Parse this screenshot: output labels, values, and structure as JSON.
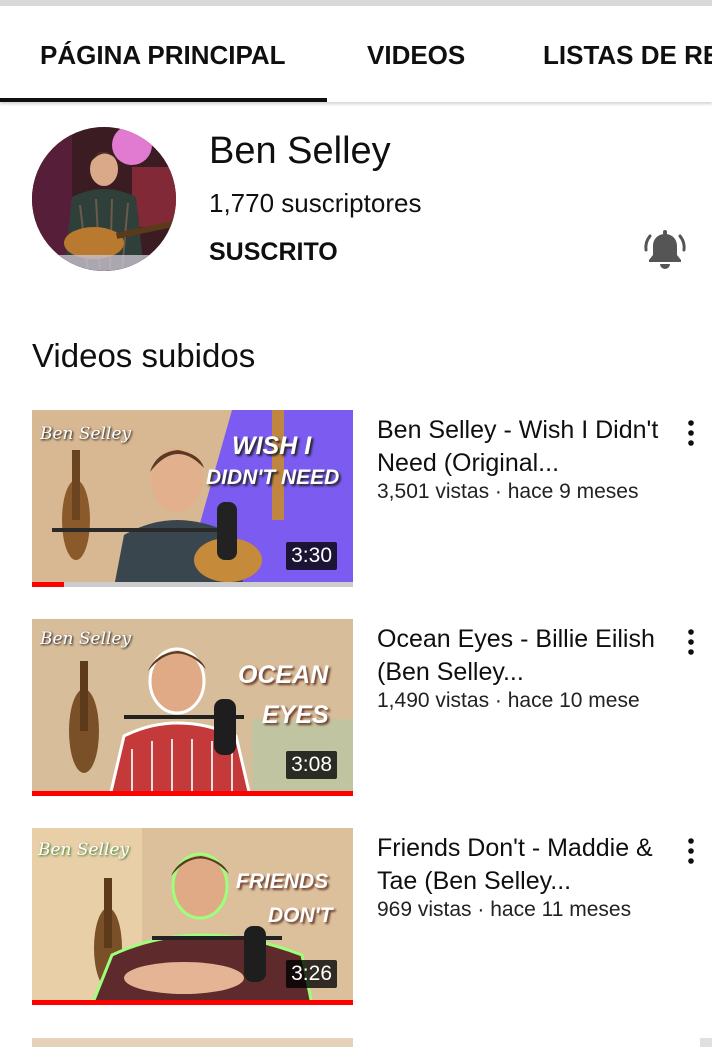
{
  "tabs": [
    {
      "label": "PÁGINA PRINCIPAL",
      "active": true
    },
    {
      "label": "VIDEOS",
      "active": false
    },
    {
      "label": "LISTAS DE RE",
      "active": false
    }
  ],
  "channel": {
    "name": "Ben Selley",
    "subscribers": "1,770 suscriptores",
    "subscribe_state": "SUSCRITO",
    "bell_icon": "notification-bell-icon"
  },
  "section": {
    "title": "Videos subidos"
  },
  "videos": [
    {
      "title": "Ben Selley - Wish I Didn't Need (Original...",
      "meta": "3,501 vistas · hace 9 meses",
      "duration": "3:30",
      "thumb_brand": "Ben Selley",
      "thumb_text": [
        "WISH I",
        "DIDN'T NEED"
      ],
      "watched_fraction": 0.1
    },
    {
      "title": "Ocean Eyes - Billie Eilish (Ben Selley...",
      "meta": "1,490 vistas · hace 10 mese",
      "duration": "3:08",
      "thumb_brand": "Ben Selley",
      "thumb_text": [
        "OCEAN",
        "EYES"
      ],
      "watched_fraction": 1.0
    },
    {
      "title": "Friends Don't - Maddie & Tae (Ben Selley...",
      "meta": "969 vistas · hace 11 meses",
      "duration": "3:26",
      "thumb_brand": "Ben Selley",
      "thumb_text": [
        "FRIENDS",
        "DON'T"
      ],
      "watched_fraction": 1.0
    }
  ],
  "colors": {
    "progress": "#ff0000",
    "accent_purple": "#7b5bf0"
  }
}
